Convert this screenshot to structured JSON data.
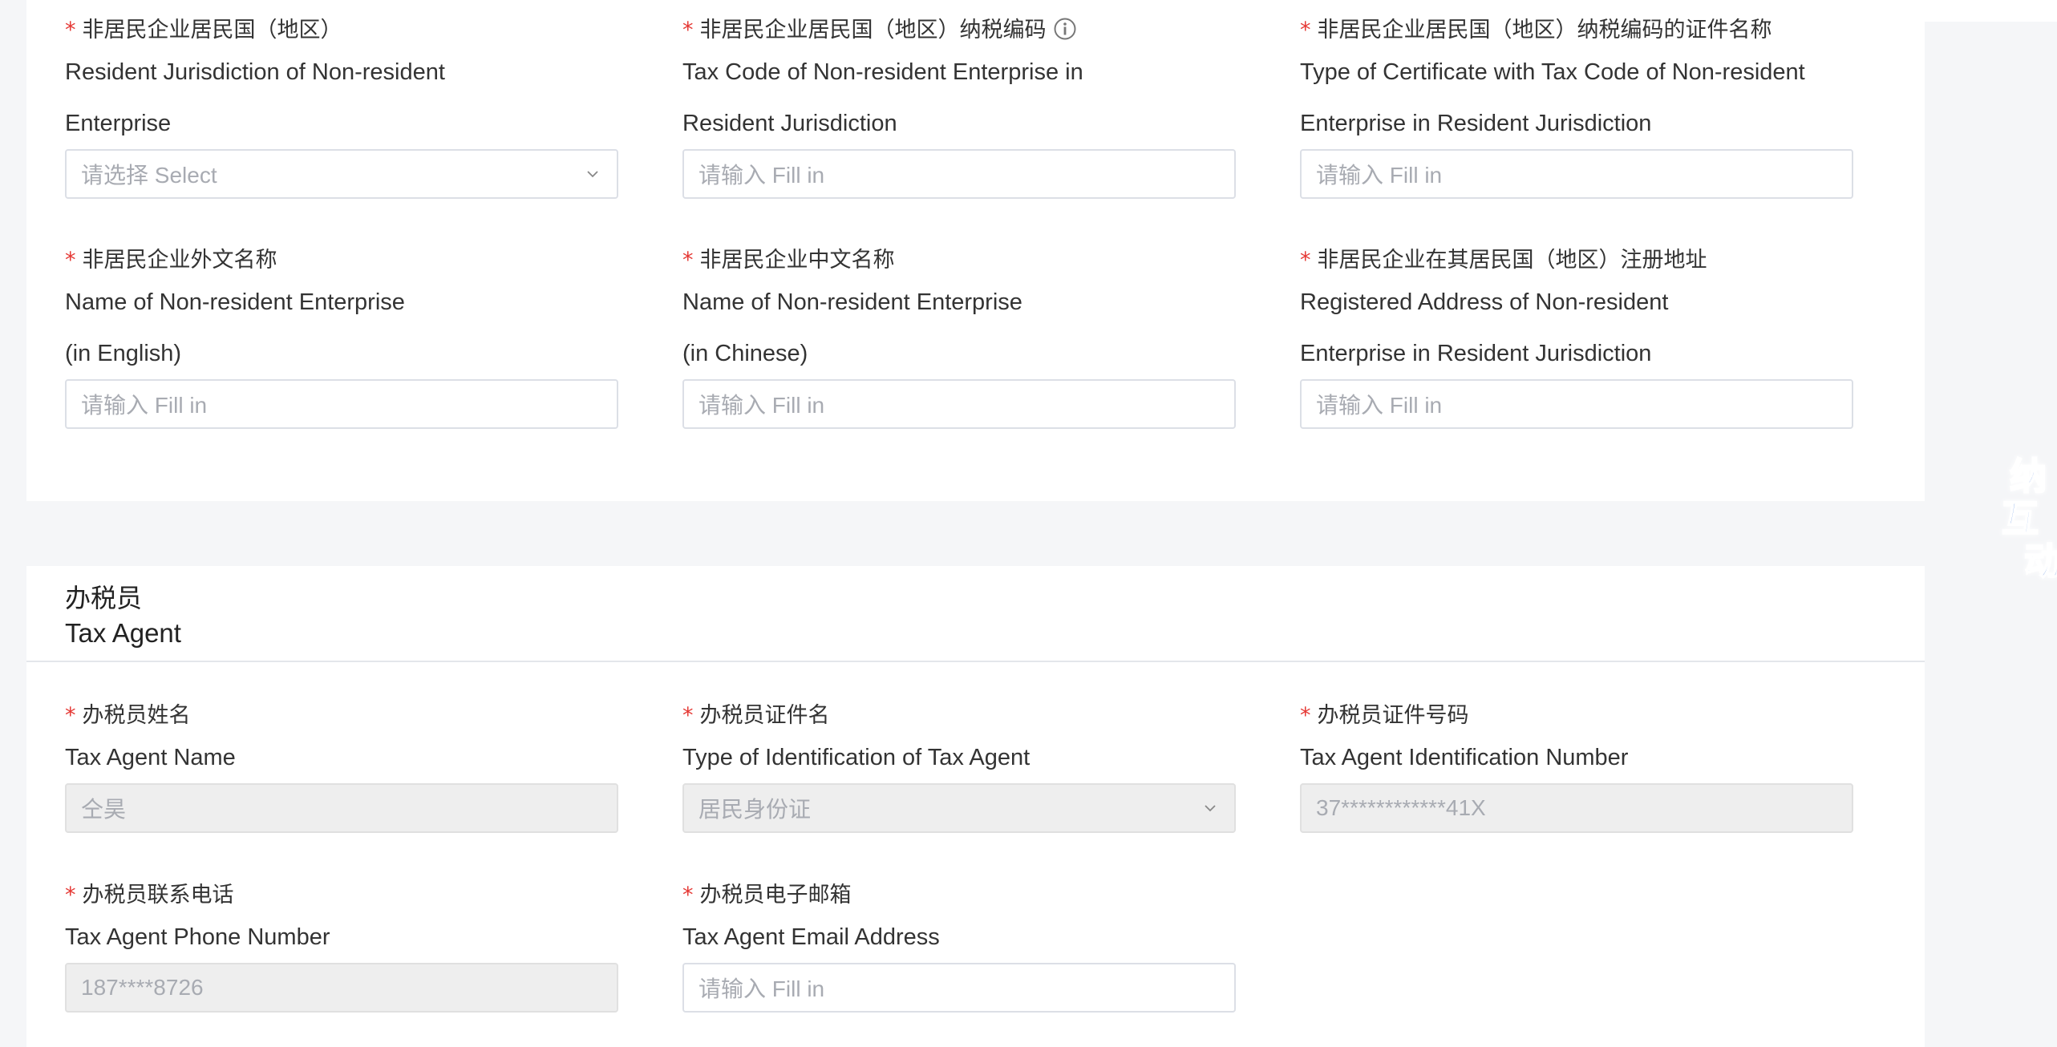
{
  "top_link_fragment": "pg",
  "nonresident_section": {
    "fields": [
      {
        "label_cn": "非居民企业居民国（地区）",
        "label_en_1": "Resident Jurisdiction of Non-resident",
        "label_en_2": "Enterprise",
        "placeholder": "请选择 Select",
        "type": "select"
      },
      {
        "label_cn": "非居民企业居民国（地区）纳税编码",
        "label_en_1": "Tax Code of Non-resident Enterprise in",
        "label_en_2": "Resident Jurisdiction",
        "placeholder": "请输入 Fill in",
        "type": "input",
        "has_info_icon": true
      },
      {
        "label_cn": "非居民企业居民国（地区）纳税编码的证件名称",
        "label_en_1": "Type of Certificate with Tax Code of Non-resident",
        "label_en_2": "Enterprise in Resident Jurisdiction",
        "placeholder": "请输入 Fill in",
        "type": "input"
      },
      {
        "label_cn": "非居民企业外文名称",
        "label_en_1": "Name of Non-resident Enterprise",
        "label_en_2": "(in English)",
        "placeholder": "请输入 Fill in",
        "type": "input"
      },
      {
        "label_cn": "非居民企业中文名称",
        "label_en_1": "Name of Non-resident Enterprise",
        "label_en_2": "(in Chinese)",
        "placeholder": "请输入 Fill in",
        "type": "input"
      },
      {
        "label_cn": "非居民企业在其居民国（地区）注册地址",
        "label_en_1": "Registered Address of Non-resident",
        "label_en_2": "Enterprise in Resident Jurisdiction",
        "placeholder": "请输入 Fill in",
        "type": "input"
      }
    ]
  },
  "tax_agent_section": {
    "title_cn": "办税员",
    "title_en": "Tax Agent",
    "fields": [
      {
        "label_cn": "办税员姓名",
        "label_en": "Tax Agent Name",
        "value": "仝昊",
        "type": "input",
        "disabled": true
      },
      {
        "label_cn": "办税员证件名",
        "label_en": "Type of Identification of Tax Agent",
        "value": "居民身份证",
        "type": "select",
        "disabled": true
      },
      {
        "label_cn": "办税员证件号码",
        "label_en": "Tax Agent Identification Number",
        "value": "37************41X",
        "type": "input",
        "disabled": true
      },
      {
        "label_cn": "办税员联系电话",
        "label_en": "Tax Agent Phone Number",
        "value": "187****8726",
        "type": "input",
        "disabled": true
      },
      {
        "label_cn": "办税员电子邮箱",
        "label_en": "Tax Agent Email Address",
        "placeholder": "请输入 Fill in",
        "type": "input",
        "disabled": false
      }
    ]
  },
  "floating_badge": {
    "chars": [
      "纳",
      "互",
      "动"
    ],
    "color": "#1a5fd6"
  },
  "colors": {
    "required_star": "#e53935",
    "border": "#dcdfe6",
    "disabled_bg": "#eeeeee",
    "page_bg": "#f5f6f8"
  }
}
